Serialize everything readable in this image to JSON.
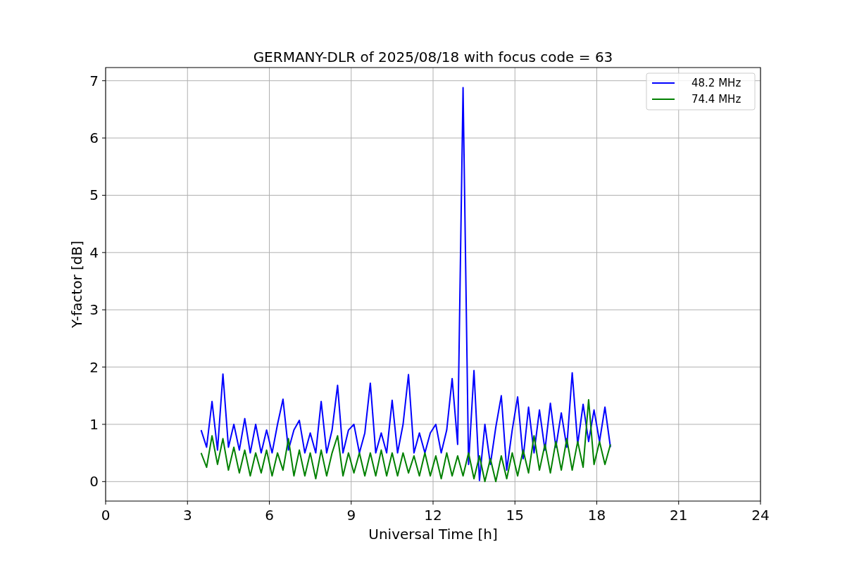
{
  "figure": {
    "chart_data": {
      "type": "line",
      "title": "GERMANY-DLR of 2025/08/18 with focus code = 63",
      "xlabel": "Universal Time [h]",
      "ylabel": "Y-factor [dB]",
      "x": [
        3.5,
        3.7,
        3.9,
        4.1,
        4.3,
        4.5,
        4.7,
        4.9,
        5.1,
        5.3,
        5.5,
        5.7,
        5.9,
        6.1,
        6.3,
        6.5,
        6.7,
        6.9,
        7.1,
        7.3,
        7.5,
        7.7,
        7.9,
        8.1,
        8.3,
        8.5,
        8.7,
        8.9,
        9.1,
        9.3,
        9.5,
        9.7,
        9.9,
        10.1,
        10.3,
        10.5,
        10.7,
        10.9,
        11.1,
        11.3,
        11.5,
        11.7,
        11.9,
        12.1,
        12.3,
        12.5,
        12.7,
        12.9,
        13.1,
        13.3,
        13.5,
        13.7,
        13.9,
        14.1,
        14.3,
        14.5,
        14.7,
        14.9,
        15.1,
        15.3,
        15.5,
        15.7,
        15.9,
        16.1,
        16.3,
        16.5,
        16.7,
        16.9,
        17.1,
        17.3,
        17.5,
        17.7,
        17.9,
        18.1,
        18.3,
        18.5
      ],
      "series": [
        {
          "name": "48.2 MHz",
          "color": "#0000ff",
          "values": [
            0.9,
            0.6,
            1.4,
            0.55,
            1.88,
            0.6,
            1.0,
            0.55,
            1.1,
            0.5,
            1.0,
            0.5,
            0.9,
            0.5,
            1.0,
            1.44,
            0.55,
            0.9,
            1.07,
            0.5,
            0.85,
            0.5,
            1.4,
            0.5,
            0.9,
            1.68,
            0.5,
            0.9,
            1.0,
            0.5,
            0.85,
            1.72,
            0.5,
            0.85,
            0.5,
            1.42,
            0.5,
            1.0,
            1.87,
            0.5,
            0.85,
            0.5,
            0.85,
            1.0,
            0.5,
            0.9,
            1.8,
            0.65,
            6.88,
            0.3,
            1.94,
            0.02,
            1.0,
            0.3,
            0.95,
            1.5,
            0.2,
            0.9,
            1.48,
            0.4,
            1.3,
            0.5,
            1.25,
            0.55,
            1.37,
            0.6,
            1.2,
            0.6,
            1.9,
            0.65,
            1.35,
            0.7,
            1.25,
            0.7,
            1.3,
            0.6
          ]
        },
        {
          "name": "74.4 MHz",
          "color": "#008000",
          "values": [
            0.5,
            0.25,
            0.8,
            0.3,
            0.75,
            0.2,
            0.6,
            0.15,
            0.55,
            0.1,
            0.5,
            0.15,
            0.55,
            0.1,
            0.5,
            0.2,
            0.75,
            0.1,
            0.55,
            0.1,
            0.5,
            0.05,
            0.55,
            0.1,
            0.5,
            0.8,
            0.1,
            0.5,
            0.15,
            0.5,
            0.1,
            0.5,
            0.1,
            0.55,
            0.1,
            0.5,
            0.1,
            0.5,
            0.15,
            0.45,
            0.1,
            0.5,
            0.1,
            0.45,
            0.05,
            0.5,
            0.1,
            0.45,
            0.1,
            0.5,
            0.05,
            0.45,
            0.0,
            0.4,
            0.0,
            0.45,
            0.05,
            0.5,
            0.1,
            0.55,
            0.15,
            0.8,
            0.2,
            0.65,
            0.15,
            0.7,
            0.2,
            0.75,
            0.2,
            0.7,
            0.25,
            1.43,
            0.3,
            0.7,
            0.3,
            0.65
          ]
        }
      ],
      "xlim": [
        0,
        24
      ],
      "ylim": [
        -0.34,
        7.23
      ],
      "xticks": [
        0,
        3,
        6,
        9,
        12,
        15,
        18,
        21,
        24
      ],
      "yticks": [
        0,
        1,
        2,
        3,
        4,
        5,
        6,
        7
      ],
      "grid": true,
      "legend": "upper right"
    }
  }
}
